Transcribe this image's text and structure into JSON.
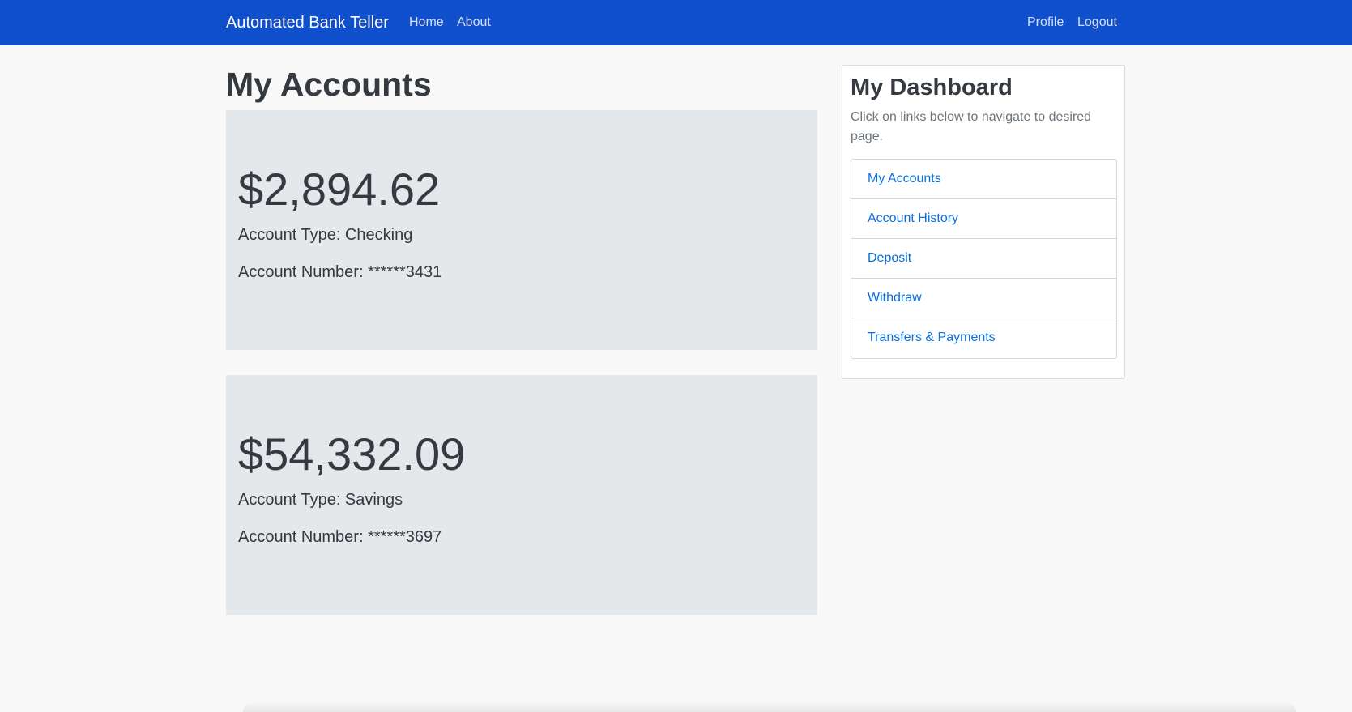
{
  "navbar": {
    "brand": "Automated Bank Teller",
    "links_left": [
      "Home",
      "About"
    ],
    "links_right": [
      "Profile",
      "Logout"
    ],
    "background": "#1150cc"
  },
  "main": {
    "title": "My Accounts",
    "accounts": [
      {
        "balance": "$2,894.62",
        "type_line": "Account Type: Checking",
        "number_line": "Account Number: ******3431"
      },
      {
        "balance": "$54,332.09",
        "type_line": "Account Type: Savings",
        "number_line": "Account Number: ******3697"
      }
    ]
  },
  "dashboard": {
    "title": "My Dashboard",
    "subtitle": "Click on links below to navigate to desired page.",
    "links": [
      "My Accounts",
      "Account History",
      "Deposit",
      "Withdraw",
      "Transfers & Payments"
    ],
    "link_color": "#0a6fe0"
  }
}
